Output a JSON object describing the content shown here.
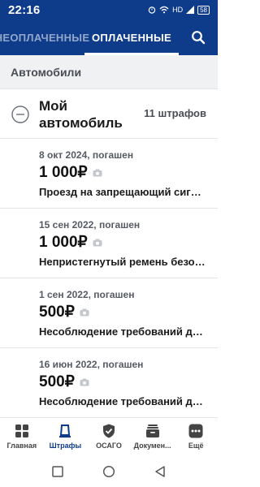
{
  "status_bar": {
    "time": "22:16",
    "net": "HD",
    "battery": "58"
  },
  "tabs": {
    "unpaid": "НЕОПЛАЧЕННЫЕ",
    "paid": "ОПЛАЧЕННЫЕ"
  },
  "section": {
    "title": "Автомобили"
  },
  "group": {
    "name": "Мой автомобиль",
    "count": "11 штрафов"
  },
  "fines": [
    {
      "date": "8 окт 2024, погашен",
      "amount": "1 000₽",
      "description": "Проезд на запрещающий сигнал светофора"
    },
    {
      "date": "15 сен 2022, погашен",
      "amount": "1 000₽",
      "description": "Непристегнутый ремень безопасности"
    },
    {
      "date": "1 сен 2022, погашен",
      "amount": "500₽",
      "description": "Несоблюдение требований дорожных знаков"
    },
    {
      "date": "16 июн 2022, погашен",
      "amount": "500₽",
      "description": "Несоблюдение требований дорожных знаков"
    }
  ],
  "bottom_nav": [
    {
      "label": "Главная",
      "icon": "grid-icon"
    },
    {
      "label": "Штрафы",
      "icon": "fines-icon"
    },
    {
      "label": "ОСАГО",
      "icon": "shield-check-icon"
    },
    {
      "label": "Докумен...",
      "icon": "documents-icon"
    },
    {
      "label": "Ещё",
      "icon": "more-icon"
    }
  ],
  "colors": {
    "brand": "#0e3b8a",
    "section_bg": "#f0f1f3"
  }
}
